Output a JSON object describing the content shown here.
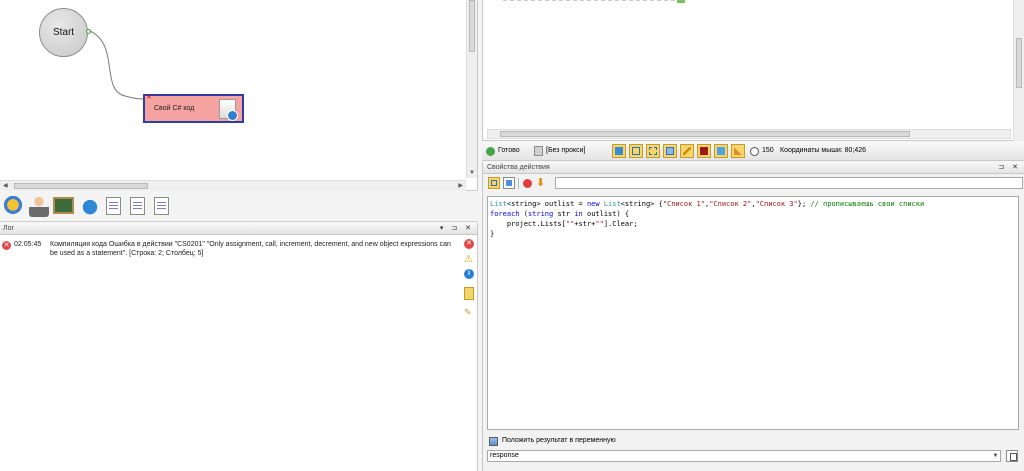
{
  "canvas": {
    "start_node_label": "Start",
    "action_node_label": "Свой C# код"
  },
  "toolbox": {
    "items": [
      "gears-icon",
      "user-icon",
      "board-icon",
      "bug-icon",
      "doc-icon",
      "doc-icon",
      "doc-icon"
    ]
  },
  "log": {
    "title": "Лог",
    "entries": [
      {
        "time": "02:05:45",
        "message": "Компиляция кода  Ошибка в действии \"CS0201\" \"Only assignment, call, increment, decrement, and new object expressions can be used as a statement\". [Строка: 2; Столбец: 5]"
      }
    ]
  },
  "statusbar": {
    "status": "Готово",
    "proxy": "[Без прокси]",
    "counter": "150",
    "mouse_coords": "Координаты мыши: 80;426"
  },
  "props": {
    "title": "Свойства действия",
    "code": {
      "line1": {
        "t1": "List",
        "t2": "<string>",
        "t3": " outlist = ",
        "t4": "new",
        "t5": " List",
        "t6": "<string>",
        "t7": " {",
        "t8": "\"Список 1\"",
        "t9": ",",
        "t10": "\"Список 2\"",
        "t11": ",",
        "t12": "\"Список 3\"",
        "t13": "}; ",
        "t14": "// прописываешь свои списки"
      },
      "line2": {
        "t1": "foreach",
        "t2": " (",
        "t3": "string",
        "t4": " str ",
        "t5": "in",
        "t6": " outlist) {"
      },
      "line3": {
        "t1": "    project.Lists[",
        "t2": "\"\"",
        "t3": "+str+",
        "t4": "\"\"",
        "t5": "].Clear;"
      },
      "line4": "}"
    },
    "save_result_label": "Положить результат в переменную",
    "variable_value": "response"
  },
  "colors": {
    "action_node_fill": "#f5a3a0",
    "action_node_border": "#2c3da6",
    "keyword": "#0000ff",
    "comment": "#008000",
    "string": "#a31515",
    "error": "#e24848",
    "ok": "#45a348"
  }
}
